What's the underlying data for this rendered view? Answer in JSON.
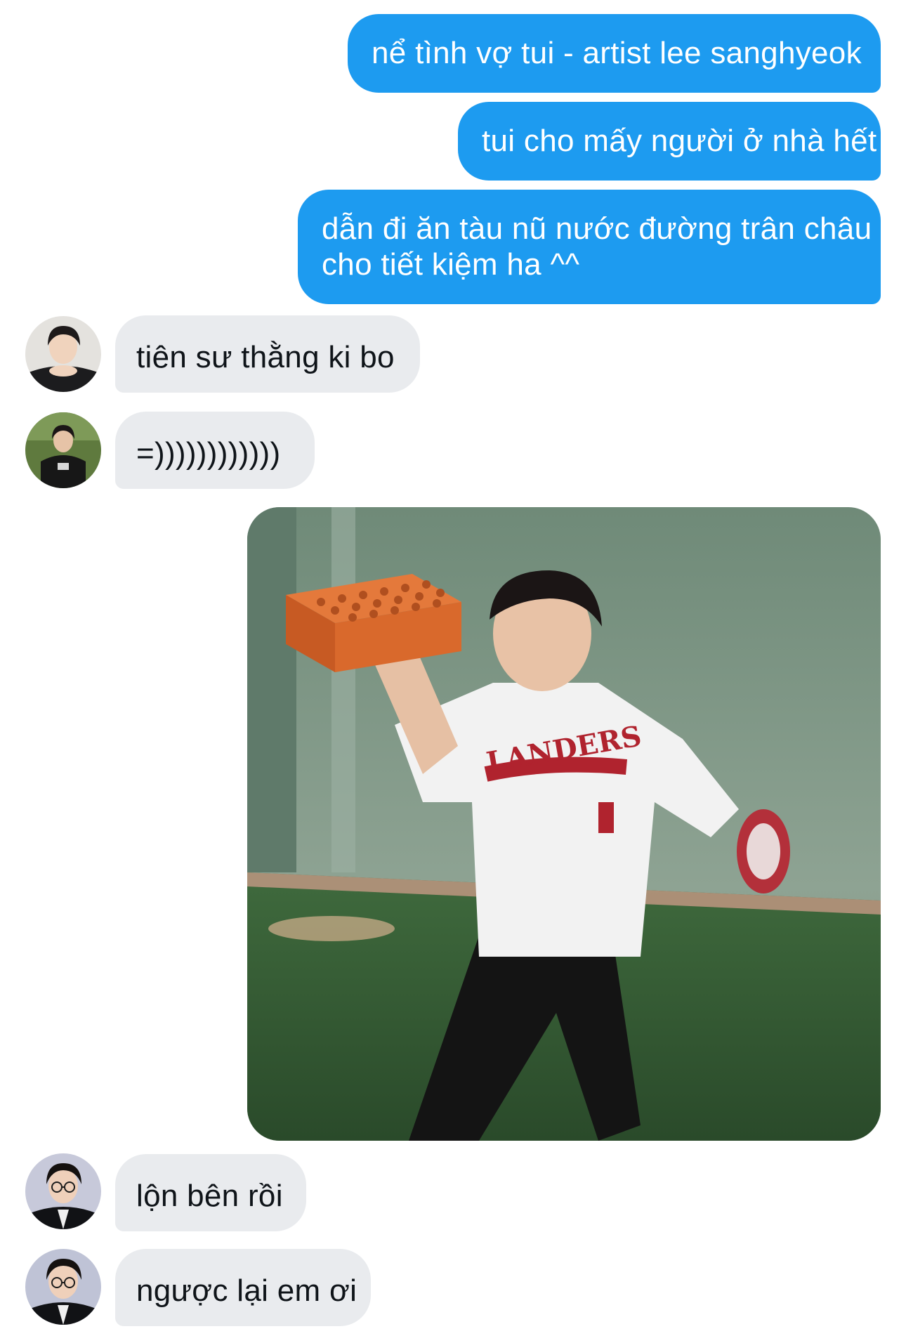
{
  "conversation": {
    "outgoing": [
      {
        "text": "nể tình vợ tui - artist lee sanghyeok"
      },
      {
        "text": "tui cho mấy người ở nhà hết"
      },
      {
        "line1": "dẫn đi ăn tàu nũ nước đường trân châu",
        "line2": "cho tiết kiệm ha ^^"
      }
    ],
    "incoming_top": [
      {
        "text": "tiên sư thằng ki bo",
        "avatar": "avatar-user-1"
      },
      {
        "text": "=))))))))))))",
        "avatar": "avatar-user-2"
      }
    ],
    "image_message": {
      "description_icon": "meme-photo",
      "jersey_text": "LANDERS"
    },
    "incoming_bottom": [
      {
        "text": "lộn bên rồi",
        "avatar": "avatar-user-3"
      },
      {
        "text": "ngược lại em ơi",
        "avatar": "avatar-user-3"
      }
    ]
  },
  "colors": {
    "outgoing_bubble": "#1d9bf0",
    "incoming_bubble": "#e9ebee",
    "outgoing_text": "#ffffff",
    "incoming_text": "#0f1419"
  }
}
